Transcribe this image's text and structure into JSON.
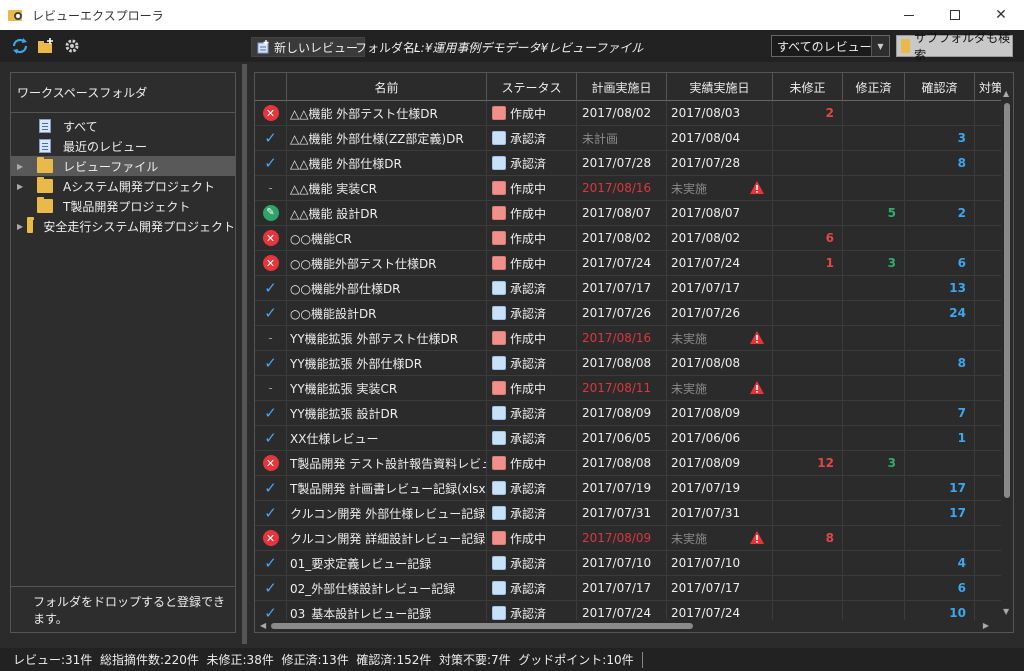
{
  "window": {
    "title": "レビューエクスプローラ"
  },
  "toolbar": {
    "new_review_label": "新しいレビュー",
    "folder_label": "フォルダ名:",
    "folder_path": "L:¥運用事例デモデータ¥レビューファイル",
    "filter_value": "すべてのレビュー",
    "subfolder_search_label": "サブフォルダも検索"
  },
  "sidebar": {
    "header": "ワークスペースフォルダ",
    "items": [
      {
        "label": "すべて",
        "icon": "document-icon",
        "expandable": false
      },
      {
        "label": "最近のレビュー",
        "icon": "document-icon",
        "expandable": false
      },
      {
        "label": "レビューファイル",
        "icon": "folder-icon",
        "expandable": true,
        "selected": true
      },
      {
        "label": "Aシステム開発プロジェクト",
        "icon": "folder-icon",
        "expandable": true
      },
      {
        "label": "T製品開発プロジェクト",
        "icon": "folder-icon",
        "expandable": false
      },
      {
        "label": "安全走行システム開発プロジェクト",
        "icon": "folder-icon",
        "expandable": true
      }
    ],
    "footer": "フォルダをドロップすると登録できます。"
  },
  "grid": {
    "columns": [
      "名前",
      "ステータス",
      "計画実施日",
      "実績実施日",
      "未修正",
      "修正済",
      "確認済",
      "対策"
    ],
    "rows": [
      {
        "icon": "x",
        "name": "△△機能 外部テスト仕様DR",
        "status": "作成中",
        "status_color": "red",
        "plan": "2017/08/02",
        "plan_style": "normal",
        "actual": "2017/08/03",
        "actual_style": "normal",
        "warn": false,
        "unfixed": "2",
        "fixed": "",
        "confirmed": ""
      },
      {
        "icon": "check",
        "name": "△△機能 外部仕様(ZZ部定義)DR",
        "status": "承認済",
        "status_color": "blue",
        "plan": "未計画",
        "plan_style": "dim",
        "actual": "2017/08/04",
        "actual_style": "normal",
        "warn": false,
        "unfixed": "",
        "fixed": "",
        "confirmed": "3"
      },
      {
        "icon": "check",
        "name": "△△機能 外部仕様DR",
        "status": "承認済",
        "status_color": "blue",
        "plan": "2017/07/28",
        "plan_style": "normal",
        "actual": "2017/07/28",
        "actual_style": "normal",
        "warn": false,
        "unfixed": "",
        "fixed": "",
        "confirmed": "8"
      },
      {
        "icon": "dash",
        "name": "△△機能 実装CR",
        "status": "作成中",
        "status_color": "red",
        "plan": "2017/08/16",
        "plan_style": "red",
        "actual": "未実施",
        "actual_style": "dim",
        "warn": true,
        "unfixed": "",
        "fixed": "",
        "confirmed": ""
      },
      {
        "icon": "pen",
        "name": "△△機能 設計DR",
        "status": "作成中",
        "status_color": "red",
        "plan": "2017/08/07",
        "plan_style": "normal",
        "actual": "2017/08/07",
        "actual_style": "normal",
        "warn": false,
        "unfixed": "",
        "fixed": "5",
        "confirmed": "2"
      },
      {
        "icon": "x",
        "name": "○○機能CR",
        "status": "作成中",
        "status_color": "red",
        "plan": "2017/08/02",
        "plan_style": "normal",
        "actual": "2017/08/02",
        "actual_style": "normal",
        "warn": false,
        "unfixed": "6",
        "fixed": "",
        "confirmed": ""
      },
      {
        "icon": "x",
        "name": "○○機能外部テスト仕様DR",
        "status": "作成中",
        "status_color": "red",
        "plan": "2017/07/24",
        "plan_style": "normal",
        "actual": "2017/07/24",
        "actual_style": "normal",
        "warn": false,
        "unfixed": "1",
        "fixed": "3",
        "confirmed": "6"
      },
      {
        "icon": "check",
        "name": "○○機能外部仕様DR",
        "status": "承認済",
        "status_color": "blue",
        "plan": "2017/07/17",
        "plan_style": "normal",
        "actual": "2017/07/17",
        "actual_style": "normal",
        "warn": false,
        "unfixed": "",
        "fixed": "",
        "confirmed": "13"
      },
      {
        "icon": "check",
        "name": "○○機能設計DR",
        "status": "承認済",
        "status_color": "blue",
        "plan": "2017/07/26",
        "plan_style": "normal",
        "actual": "2017/07/26",
        "actual_style": "normal",
        "warn": false,
        "unfixed": "",
        "fixed": "",
        "confirmed": "24"
      },
      {
        "icon": "dash",
        "name": "YY機能拡張 外部テスト仕様DR",
        "status": "作成中",
        "status_color": "red",
        "plan": "2017/08/16",
        "plan_style": "red",
        "actual": "未実施",
        "actual_style": "dim",
        "warn": true,
        "unfixed": "",
        "fixed": "",
        "confirmed": ""
      },
      {
        "icon": "check",
        "name": "YY機能拡張 外部仕様DR",
        "status": "承認済",
        "status_color": "blue",
        "plan": "2017/08/08",
        "plan_style": "normal",
        "actual": "2017/08/08",
        "actual_style": "normal",
        "warn": false,
        "unfixed": "",
        "fixed": "",
        "confirmed": "8"
      },
      {
        "icon": "dash",
        "name": "YY機能拡張 実装CR",
        "status": "作成中",
        "status_color": "red",
        "plan": "2017/08/11",
        "plan_style": "red",
        "actual": "未実施",
        "actual_style": "dim",
        "warn": true,
        "unfixed": "",
        "fixed": "",
        "confirmed": ""
      },
      {
        "icon": "check",
        "name": "YY機能拡張 設計DR",
        "status": "承認済",
        "status_color": "blue",
        "plan": "2017/08/09",
        "plan_style": "normal",
        "actual": "2017/08/09",
        "actual_style": "normal",
        "warn": false,
        "unfixed": "",
        "fixed": "",
        "confirmed": "7"
      },
      {
        "icon": "check",
        "name": "XX仕様レビュー",
        "status": "承認済",
        "status_color": "blue",
        "plan": "2017/06/05",
        "plan_style": "normal",
        "actual": "2017/06/06",
        "actual_style": "normal",
        "warn": false,
        "unfixed": "",
        "fixed": "",
        "confirmed": "1"
      },
      {
        "icon": "x",
        "name": "T製品開発 テスト設計報告資料レビュー",
        "status": "作成中",
        "status_color": "red",
        "plan": "2017/08/08",
        "plan_style": "normal",
        "actual": "2017/08/09",
        "actual_style": "normal",
        "warn": false,
        "unfixed": "12",
        "fixed": "3",
        "confirmed": ""
      },
      {
        "icon": "check",
        "name": "T製品開発 計画書レビュー記録(xlsxデ",
        "status": "承認済",
        "status_color": "blue",
        "plan": "2017/07/19",
        "plan_style": "normal",
        "actual": "2017/07/19",
        "actual_style": "normal",
        "warn": false,
        "unfixed": "",
        "fixed": "",
        "confirmed": "17"
      },
      {
        "icon": "check",
        "name": "クルコン開発 外部仕様レビュー記録",
        "status": "承認済",
        "status_color": "blue",
        "plan": "2017/07/31",
        "plan_style": "normal",
        "actual": "2017/07/31",
        "actual_style": "normal",
        "warn": false,
        "unfixed": "",
        "fixed": "",
        "confirmed": "17"
      },
      {
        "icon": "x",
        "name": "クルコン開発 詳細設計レビュー記録",
        "status": "作成中",
        "status_color": "red",
        "plan": "2017/08/09",
        "plan_style": "red",
        "actual": "未実施",
        "actual_style": "dim",
        "warn": true,
        "unfixed": "8",
        "fixed": "",
        "confirmed": ""
      },
      {
        "icon": "check",
        "name": "01_要求定義レビュー記録",
        "status": "承認済",
        "status_color": "blue",
        "plan": "2017/07/10",
        "plan_style": "normal",
        "actual": "2017/07/10",
        "actual_style": "normal",
        "warn": false,
        "unfixed": "",
        "fixed": "",
        "confirmed": "4"
      },
      {
        "icon": "check",
        "name": "02_外部仕様設計レビュー記録",
        "status": "承認済",
        "status_color": "blue",
        "plan": "2017/07/17",
        "plan_style": "normal",
        "actual": "2017/07/17",
        "actual_style": "normal",
        "warn": false,
        "unfixed": "",
        "fixed": "",
        "confirmed": "6"
      },
      {
        "icon": "check",
        "name": "03_基本設計レビュー記録",
        "status": "承認済",
        "status_color": "blue",
        "plan": "2017/07/24",
        "plan_style": "normal",
        "actual": "2017/07/24",
        "actual_style": "normal",
        "warn": false,
        "unfixed": "",
        "fixed": "",
        "confirmed": "10"
      }
    ]
  },
  "statusbar": {
    "text": "レビュー:31件  総指摘件数:220件  未修正:38件  修正済:13件  確認済:152件  対策不要:7件  グッドポイント:10件"
  },
  "colors": {
    "background": "#2b2b2b",
    "status_red": "#f0908a",
    "status_blue": "#c9e1f7",
    "unfixed": "#e04848",
    "fixed": "#2fae6e",
    "confirmed": "#3ca7ee",
    "error_icon": "#e8343b",
    "check_icon": "#4aa6f0"
  }
}
